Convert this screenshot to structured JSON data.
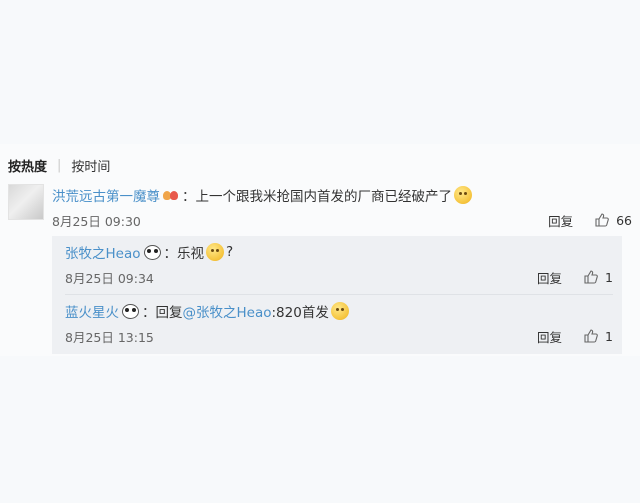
{
  "sort": {
    "hot_label": "按热度",
    "time_label": "按时间"
  },
  "comment": {
    "username": "洪荒远古第一魔尊",
    "colon": "：",
    "text": "上一个跟我米抢国内首发的厂商已经破产了",
    "time": "8月25日 09:30",
    "reply_label": "回复",
    "likes": "66",
    "badge_icon": "hearts-badge-icon",
    "emoji_icon": "grin-emoji-icon"
  },
  "replies": [
    {
      "username": "张牧之Heao",
      "colon": "：",
      "text": "乐视",
      "suffix": "?",
      "time": "8月25日 09:34",
      "reply_label": "回复",
      "likes": "1"
    },
    {
      "username": "蓝火星火",
      "colon": "：",
      "prefix": "回复",
      "mention": "@张牧之Heao",
      "text": ":820首发",
      "time": "8月25日 13:15",
      "reply_label": "回复",
      "likes": "1"
    }
  ],
  "colors": {
    "link": "#4a90c9",
    "background": "#f7f9fb",
    "reply_bg": "#eef0f3"
  }
}
